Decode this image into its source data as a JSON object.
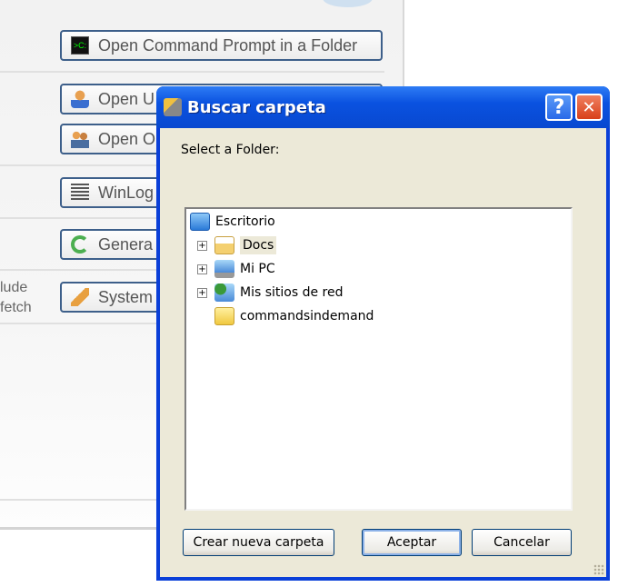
{
  "background": {
    "buttons": [
      {
        "label": "Open Command Prompt in a Folder",
        "icon": "command-prompt-icon"
      },
      {
        "label": "Open U",
        "icon": "user-icon"
      },
      {
        "label": "Open O",
        "icon": "users-icon"
      },
      {
        "label": "WinLog",
        "icon": "log-icon"
      },
      {
        "label": "Genera",
        "icon": "refresh-icon"
      },
      {
        "label": "System",
        "icon": "broom-icon"
      }
    ],
    "side_text": [
      "lude",
      "fetch"
    ]
  },
  "dialog": {
    "title": "Buscar carpeta",
    "help": "?",
    "close": "✕",
    "prompt": "Select a Folder:",
    "tree": [
      {
        "label": "Escritorio",
        "expandable": false,
        "selected": false
      },
      {
        "label": "Docs",
        "expandable": true,
        "selected": true
      },
      {
        "label": "Mi PC",
        "expandable": true,
        "selected": false
      },
      {
        "label": "Mis sitios de red",
        "expandable": true,
        "selected": false
      },
      {
        "label": "commandsindemand",
        "expandable": false,
        "selected": false
      }
    ],
    "expander": "+",
    "new_folder": "Crear nueva carpeta",
    "ok": "Aceptar",
    "cancel": "Cancelar"
  },
  "colors": {
    "title_blue": "#0a52e0",
    "dialog_face": "#ece9d8",
    "close_red": "#e0502a"
  }
}
